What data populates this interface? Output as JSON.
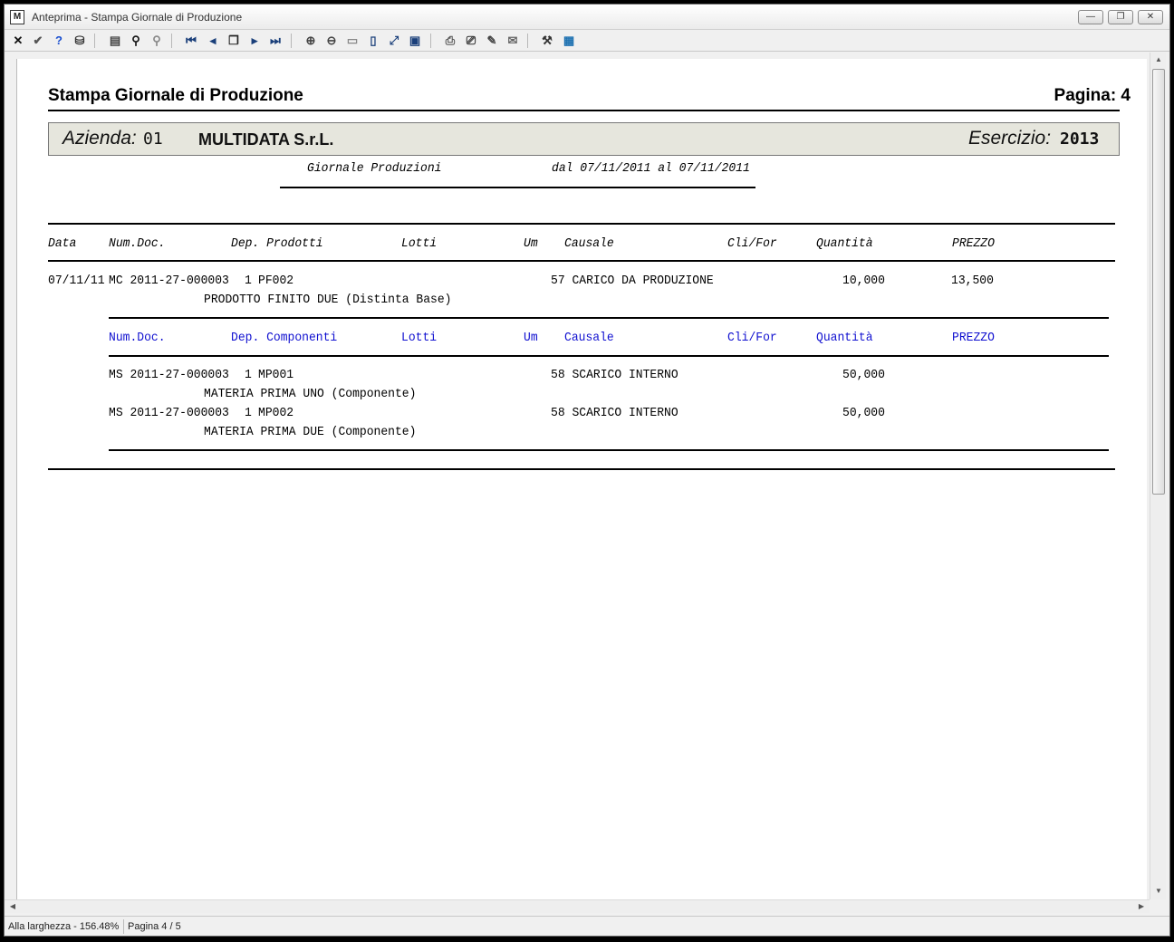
{
  "window": {
    "title": "Anteprima - Stampa Giornale di Produzione",
    "app_icon": "app-icon",
    "buttons": {
      "minimize": "—",
      "maximize": "❐",
      "close": "✕"
    }
  },
  "toolbar": {
    "icons": [
      {
        "name": "close-preview-icon",
        "glyph": "✕"
      },
      {
        "name": "confirm-icon",
        "glyph": "✔"
      },
      {
        "name": "help-icon",
        "glyph": "?"
      },
      {
        "name": "export-icon",
        "glyph": "⛁"
      },
      {
        "name": "setup-icon",
        "glyph": "▤"
      },
      {
        "name": "find-icon",
        "glyph": "⚲"
      },
      {
        "name": "find-next-icon",
        "glyph": "⚲"
      },
      {
        "name": "first-page-icon",
        "glyph": "⏮"
      },
      {
        "name": "prev-page-icon",
        "glyph": "◂"
      },
      {
        "name": "page-select-icon",
        "glyph": "❐"
      },
      {
        "name": "next-page-icon",
        "glyph": "▸"
      },
      {
        "name": "last-page-icon",
        "glyph": "⏭"
      },
      {
        "name": "zoom-in-icon",
        "glyph": "⊕"
      },
      {
        "name": "zoom-out-icon",
        "glyph": "⊖"
      },
      {
        "name": "zoom-width-icon",
        "glyph": "▭"
      },
      {
        "name": "zoom-page-icon",
        "glyph": "▯"
      },
      {
        "name": "zoom-fit-icon",
        "glyph": "⤢"
      },
      {
        "name": "zoom-100-icon",
        "glyph": "▣"
      },
      {
        "name": "print-icon",
        "glyph": "⎙"
      },
      {
        "name": "print-setup-icon",
        "glyph": "⎚"
      },
      {
        "name": "edit-icon",
        "glyph": "✎"
      },
      {
        "name": "email-icon",
        "glyph": "✉"
      },
      {
        "name": "tools-icon",
        "glyph": "⚒"
      },
      {
        "name": "calculator-icon",
        "glyph": "▦"
      }
    ]
  },
  "report": {
    "title": "Stampa Giornale di Produzione",
    "page_label": "Pagina: 4",
    "azienda_label": "Azienda:",
    "azienda_code": "01",
    "azienda_name": "MULTIDATA S.r.L.",
    "esercizio_label": "Esercizio:",
    "esercizio_value": "2013",
    "subtitle": "Giornale Produzioni",
    "period": "dal 07/11/2011 al 07/11/2011",
    "header_columns": {
      "data": "Data",
      "numdoc": "Num.Doc.",
      "dep_prodotti": "Dep. Prodotti",
      "lotti": "Lotti",
      "um": "Um",
      "causale": "Causale",
      "clifor": "Cli/For",
      "quantita": "Quantità",
      "prezzo": "PREZZO"
    },
    "product_row": {
      "data": "07/11/11",
      "numdoc": "MC 2011-27-000003",
      "dep": "1",
      "codice": "PF002",
      "causale": "57 CARICO DA PRODUZIONE",
      "quantita": "10,000",
      "prezzo": "13,500",
      "descrizione": "PRODOTTO FINITO DUE (Distinta Base)"
    },
    "component_columns": {
      "numdoc": "Num.Doc.",
      "dep_componenti": "Dep. Componenti",
      "lotti": "Lotti",
      "um": "Um",
      "causale": "Causale",
      "clifor": "Cli/For",
      "quantita": "Quantità",
      "prezzo": "PREZZO"
    },
    "components": [
      {
        "numdoc": "MS 2011-27-000003",
        "dep": "1",
        "codice": "MP001",
        "causale": "58 SCARICO INTERNO",
        "quantita": "50,000",
        "descrizione": "MATERIA PRIMA UNO (Componente)"
      },
      {
        "numdoc": "MS 2011-27-000003",
        "dep": "1",
        "codice": "MP002",
        "causale": "58 SCARICO INTERNO",
        "quantita": "50,000",
        "descrizione": "MATERIA PRIMA DUE (Componente)"
      }
    ]
  },
  "statusbar": {
    "zoom": "Alla larghezza - 156.48%",
    "page": "Pagina 4 / 5"
  }
}
